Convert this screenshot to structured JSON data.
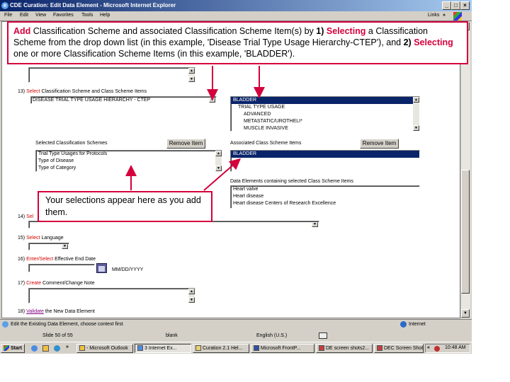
{
  "window": {
    "title": "CDE Curation: Edit Data Element - Microsoft Internet Explorer",
    "min_label": "_",
    "max_label": "□",
    "close_label": "×"
  },
  "menubar": {
    "items": [
      "File",
      "Edit",
      "View",
      "Favorites",
      "Tools",
      "Help"
    ],
    "links_label": "Links",
    "links_chevron": "»"
  },
  "form": {
    "q13_num": "13)",
    "q13_select": "Select",
    "q13_label": "Classification Scheme and Class Scheme Items",
    "scheme_value": "DISEASE TRIAL TYPE USAGE HIERARCHY - CTEP",
    "csi_list": [
      {
        "label": "BLADDER",
        "selected": true,
        "indent": 0
      },
      {
        "label": "TRIAL TYPE USAGE",
        "selected": false,
        "indent": 1
      },
      {
        "label": "ADVANCED",
        "selected": false,
        "indent": 2
      },
      {
        "label": "METASTATIC/UROTHELI*",
        "selected": false,
        "indent": 2
      },
      {
        "label": "MUSCLE INVASIVE",
        "selected": false,
        "indent": 2
      }
    ],
    "selected_schemes_label": "Selected Classification Schemes",
    "remove_item_label": "Remove Item",
    "selected_schemes": [
      "Trial Type Usages for Protocols",
      "Type of Disease",
      "Type of Category"
    ],
    "assoc_csi_label": "Associated Class Scheme Items",
    "assoc_csi": [
      "BLADDER"
    ],
    "data_elements_label": "Data Elements containing selected Class Scheme Items",
    "data_elements": [
      "Heart valve",
      "Heart disease",
      "Heart disease Centers of Research Excellence"
    ],
    "q14_num": "14)",
    "q14_select": "Sel",
    "q15_num": "15)",
    "q15_select": "Select",
    "q15_label": "Language",
    "q16_num": "16)",
    "q16_select": "Enter/Select",
    "q16_label": "Effective End Date",
    "date_format": "MM/DD/YYYY",
    "q17_num": "17)",
    "q17_select": "Create",
    "q17_label": "Comment/Change Note",
    "q18_num": "18)",
    "q18_link": "Validate",
    "q18_label": "the New Data Element"
  },
  "statusbar": {
    "message": "Edit the Existing Data Element, choose context first",
    "zone": "Internet"
  },
  "ppt_status": {
    "slide": "Slide 50 of 55",
    "design": "blank",
    "language": "English (U.S.)"
  },
  "taskbar": {
    "start": "Start",
    "quick_chevron": "»",
    "tasks": [
      {
        "label": "- Microsoft Outlook",
        "active": false
      },
      {
        "label": "3 Internet Ex...",
        "active": true
      },
      {
        "label": "Curation 2.1 Hel...",
        "active": false
      },
      {
        "label": "Microsoft FrontP...",
        "active": false
      },
      {
        "label": "DE screen shots2...",
        "active": false
      },
      {
        "label": "DEC Screen Shot...",
        "active": false
      }
    ],
    "tray_chevron": "«",
    "time": "10:48 AM"
  },
  "callouts": {
    "top": {
      "add": "Add",
      "text1": " Classification Scheme and associated Classification Scheme Item(s) by ",
      "num1": "1)",
      "selecting1": "Selecting",
      "text2": " a Classification Scheme from the drop down list (in this example, 'Disease Trial Type Usage Hierarchy-CTEP'), and ",
      "num2": "2)",
      "selecting2": "Selecting",
      "text3": " one or more Classification Scheme Items (in this example, 'BLADDER')."
    },
    "bottom": "Your selections appear here as you add them."
  },
  "colors": {
    "callout_border": "#d4003c",
    "selection": "#0a246a",
    "required_red": "#d40000"
  }
}
